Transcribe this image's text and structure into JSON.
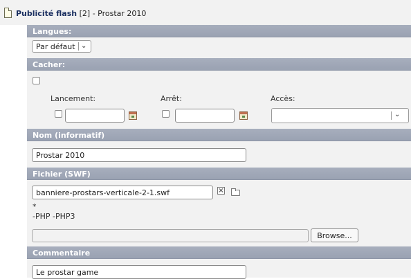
{
  "header": {
    "title": "Publicité flash",
    "count": "[2]",
    "record": "- Prostar 2010"
  },
  "langues": {
    "heading": "Langues:",
    "select_value": "Par défaut"
  },
  "cacher": {
    "heading": "Cacher:",
    "lancement_label": "Lancement:",
    "arret_label": "Arrêt:",
    "acces_label": "Accès:",
    "lancement_value": "",
    "arret_value": "",
    "acces_value": ""
  },
  "nom": {
    "heading": "Nom (informatif)",
    "value": "Prostar 2010"
  },
  "fichier": {
    "heading": "Fichier (SWF)",
    "value": "banniere-prostars-verticale-2-1.swf",
    "asterisk": "*",
    "allowed_types": "-PHP -PHP3",
    "upload_value": "",
    "browse_label": "Browse..."
  },
  "commentaire": {
    "heading": "Commentaire",
    "value": "Le prostar game"
  },
  "icons": {
    "document": "document-icon",
    "calendar": "calendar-icon",
    "clear": "clear-x-icon",
    "folder": "folder-icon",
    "dropdown": "chevron-down-icon"
  }
}
